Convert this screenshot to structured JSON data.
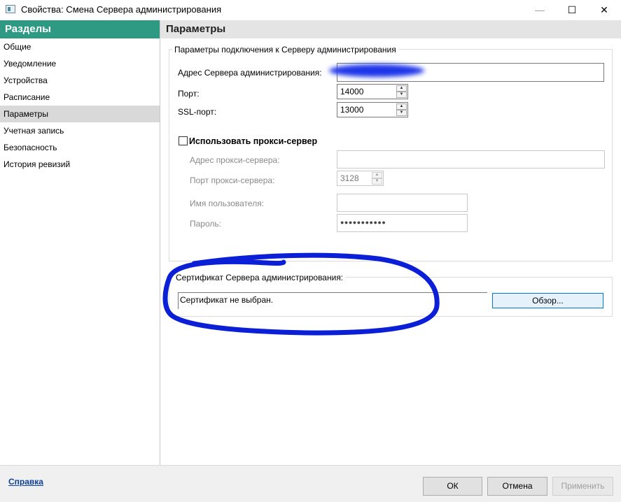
{
  "window": {
    "title": "Свойства: Смена Сервера администрирования",
    "minimize_glyph": "—",
    "maximize_glyph": "☐",
    "close_glyph": "✕"
  },
  "nav": {
    "header": "Разделы",
    "items": [
      {
        "label": "Общие",
        "selected": false
      },
      {
        "label": "Уведомление",
        "selected": false
      },
      {
        "label": "Устройства",
        "selected": false
      },
      {
        "label": "Расписание",
        "selected": false
      },
      {
        "label": "Параметры",
        "selected": true
      },
      {
        "label": "Учетная запись",
        "selected": false
      },
      {
        "label": "Безопасность",
        "selected": false
      },
      {
        "label": "История ревизий",
        "selected": false
      }
    ]
  },
  "panel": {
    "title": "Параметры",
    "connection": {
      "group_title": "Параметры подключения к Серверу администрирования",
      "address_label": "Адрес Сервера администрирования:",
      "address_value": "",
      "port_label": "Порт:",
      "port_value": "14000",
      "ssl_port_label": "SSL-порт:",
      "ssl_port_value": "13000"
    },
    "proxy": {
      "checkbox_label": "Использовать прокси-сервер",
      "checked": false,
      "address_label": "Адрес прокси-сервера:",
      "address_value": "",
      "port_label": "Порт прокси-сервера:",
      "port_value": "3128",
      "username_label": "Имя пользователя:",
      "username_value": "",
      "password_label": "Пароль:",
      "password_value": "●●●●●●●●●●●"
    },
    "certificate": {
      "group_title": "Сертификат Сервера администрирования:",
      "value": "Сертификат не выбран.",
      "browse_label": "Обзор..."
    }
  },
  "footer": {
    "help_label": "Справка",
    "ok_label": "ОК",
    "cancel_label": "Отмена",
    "apply_label": "Применить"
  },
  "annotation": {
    "blur_color": "#1f35e8",
    "circle_color": "#0b1fd6"
  },
  "colors": {
    "nav_header_bg": "#2f9a84",
    "selected_item_bg": "#d9d9d9",
    "link": "#0b3f9c"
  }
}
